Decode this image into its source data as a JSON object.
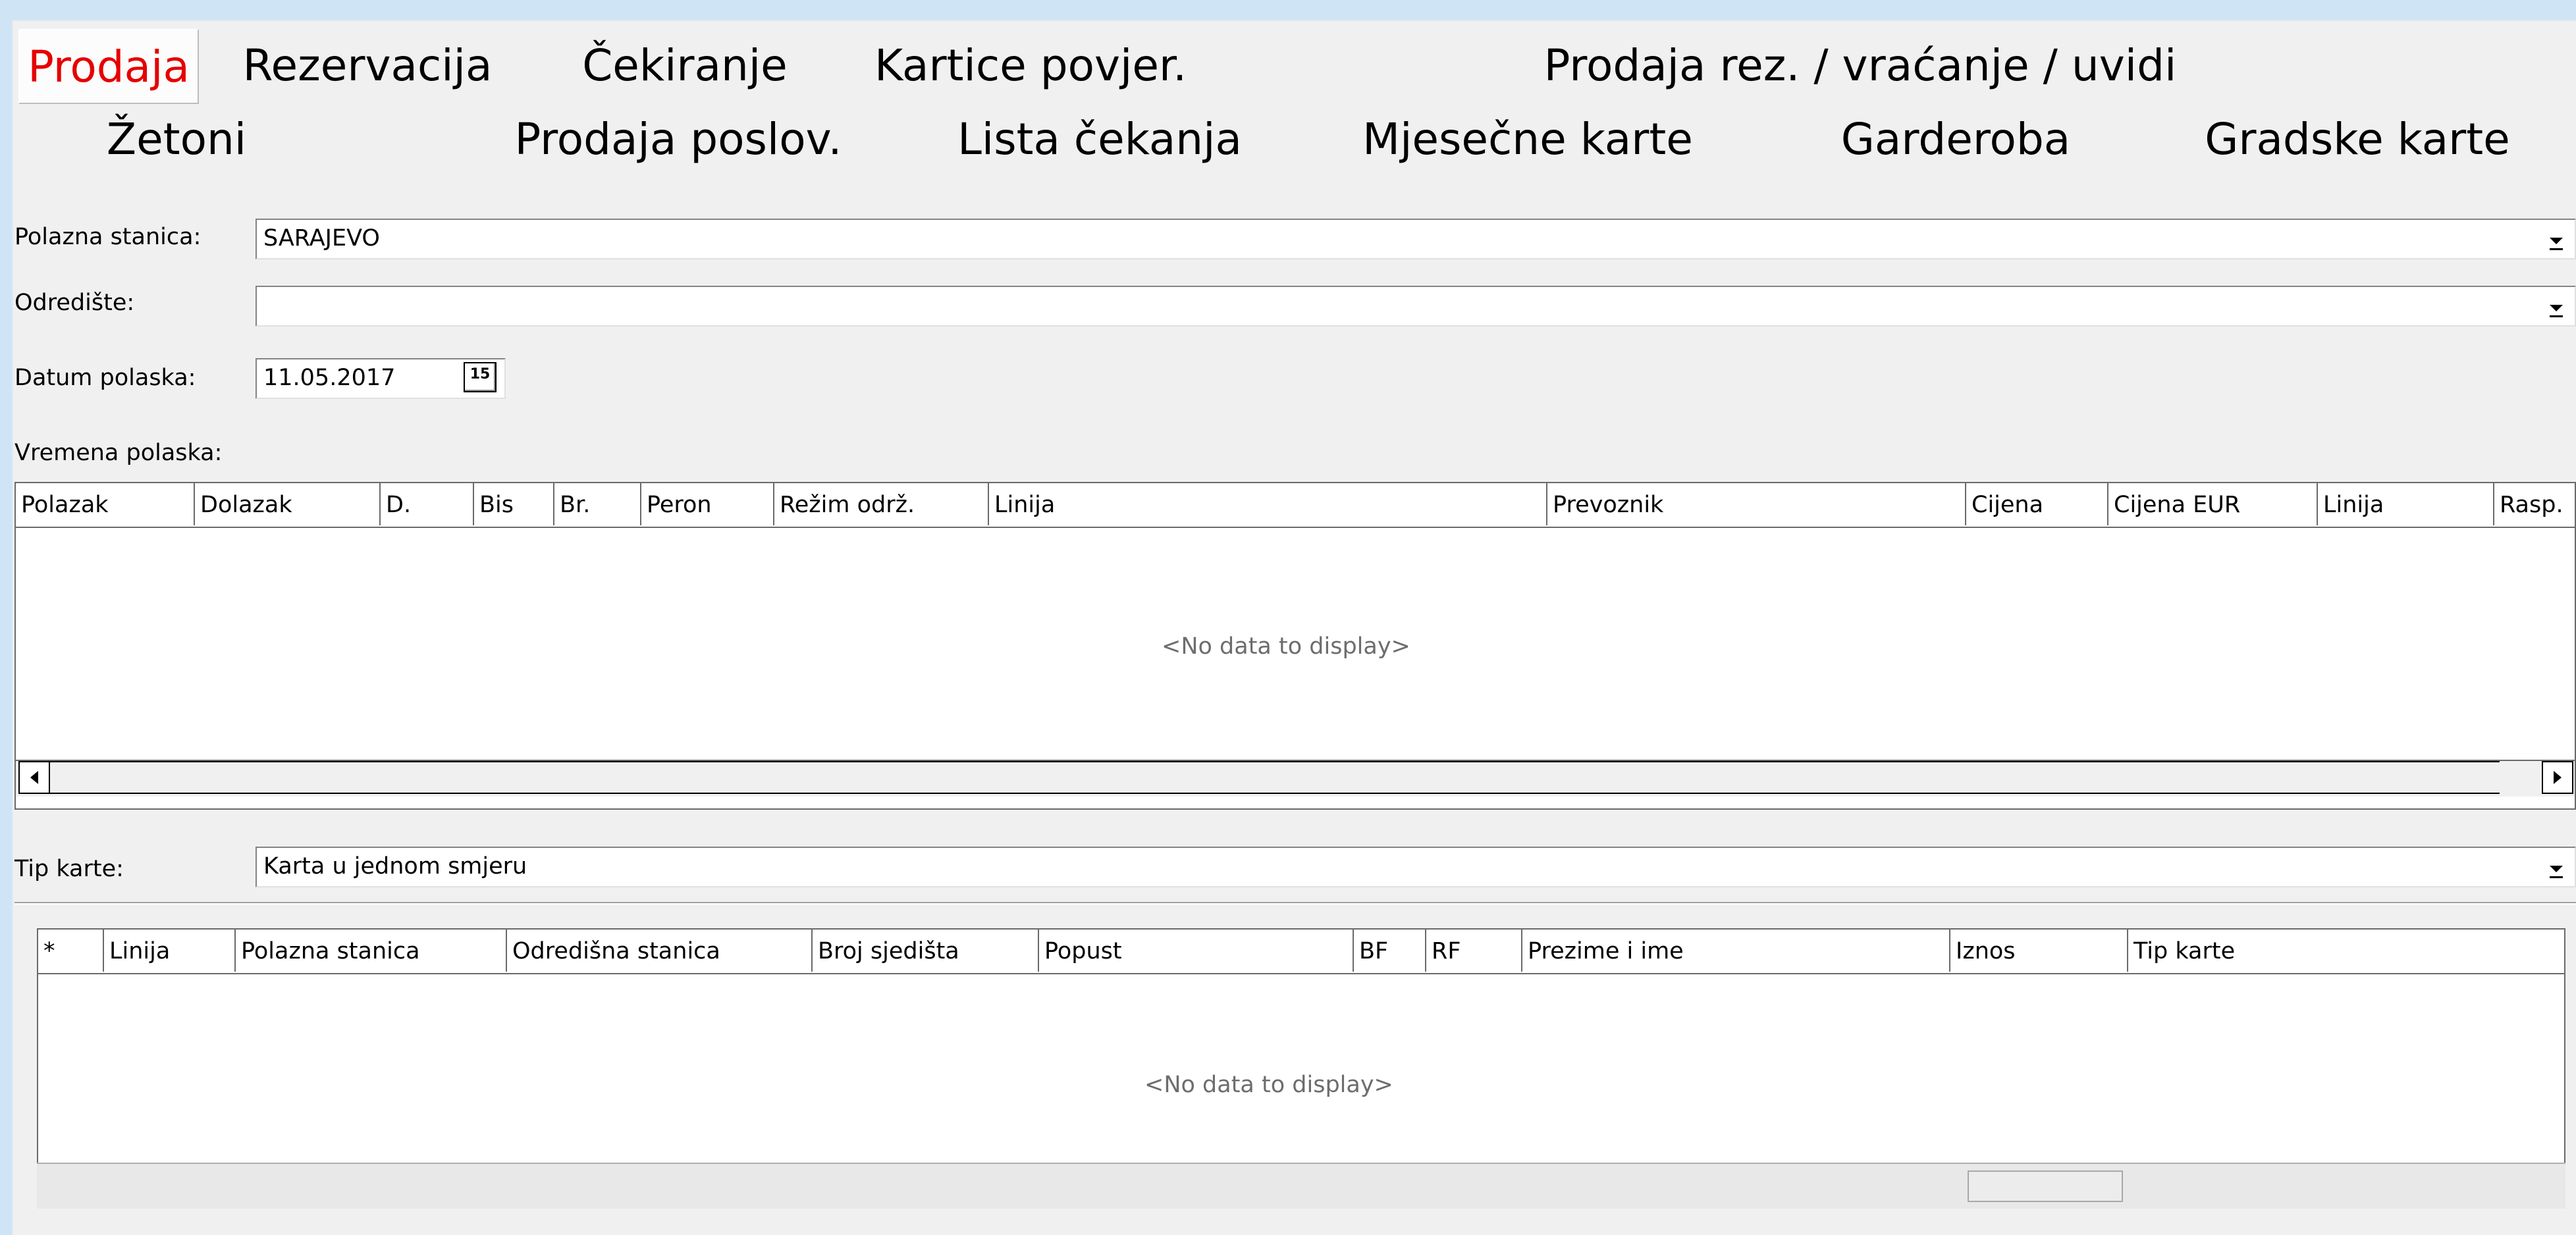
{
  "nav": {
    "row1": [
      "Prodaja",
      "Rezervacija",
      "Čekiranje",
      "Kartice povjer.",
      "Prodaja rez. / vraćanje / uvidi"
    ],
    "row2": [
      "Žetoni",
      "Prodaja poslov.",
      "Lista čekanja",
      "Mjesečne karte",
      "Garderoba",
      "Gradske karte"
    ],
    "active": "Prodaja"
  },
  "form": {
    "polazna_label": "Polazna stanica:",
    "polazna_value": "SARAJEVO",
    "odrediste_label": "Odredište:",
    "odrediste_value": "",
    "datum_label": "Datum polaska:",
    "datum_value": "11.05.2017",
    "calendar_glyph": "15",
    "vremena_label": "Vremena polaska:",
    "tip_label": "Tip karte:",
    "tip_value": "Karta u jednom smjeru"
  },
  "departures_grid": {
    "columns": [
      "Polazak",
      "Dolazak",
      "D.",
      "Bis",
      "Br.",
      "Peron",
      "Režim održ.",
      "Linija",
      "Prevoznik",
      "Cijena",
      "Cijena EUR",
      "Linija",
      "Rasp."
    ],
    "empty_text": "<No data to display>"
  },
  "tickets_grid": {
    "columns": [
      "*",
      "Linija",
      "Polazna stanica",
      "Odredišna stanica",
      "Broj sjedišta",
      "Popust",
      "BF",
      "RF",
      "Prezime i ime",
      "Iznos",
      "Tip karte"
    ],
    "empty_text": "<No data to display>"
  },
  "icons": {
    "dropdown": "chevron-down-icon",
    "calendar": "calendar-icon",
    "scroll_left": "scroll-left-icon",
    "scroll_right": "scroll-right-icon"
  },
  "colors": {
    "active_nav": "#e60000",
    "background": "#f0f0f0",
    "desktop": "#cfe5f6"
  }
}
